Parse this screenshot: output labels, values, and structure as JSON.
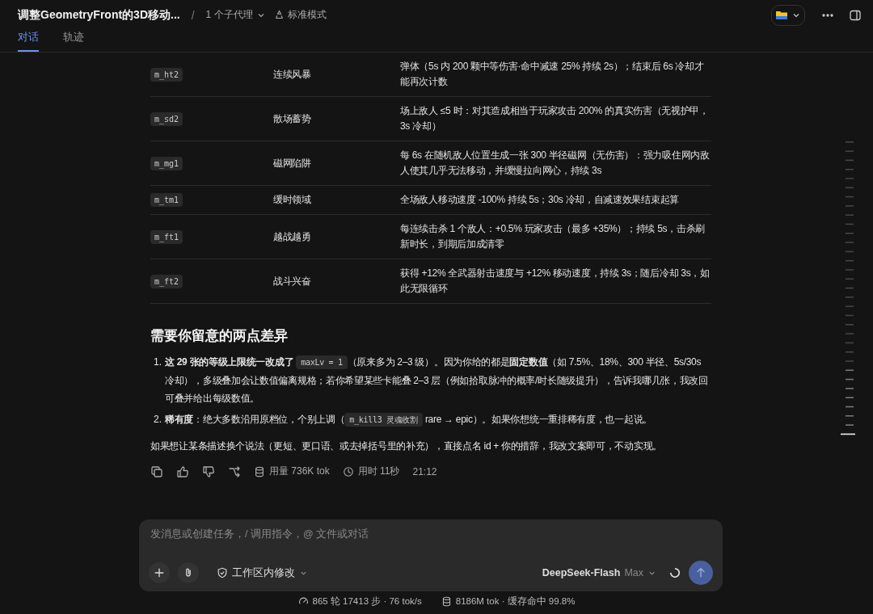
{
  "header": {
    "title": "调整GeometryFront的3D移动...",
    "separator": "/",
    "subagents": "1 个子代理",
    "mode": "标准模式"
  },
  "tabs": [
    {
      "label": "对话",
      "selected": true
    },
    {
      "label": "轨迹",
      "selected": false
    }
  ],
  "table": {
    "rows": [
      {
        "id": "m_ht2",
        "name": "连续风暴",
        "description": "弹体（5s 内 200 颗中等伤害·命中减速 25% 持续 2s）；结束后 6s 冷却才能再次计数"
      },
      {
        "id": "m_sd2",
        "name": "散场蓄势",
        "description": "场上敌人 ≤5 时：对其造成相当于玩家攻击 200% 的真实伤害（无视护甲，3s 冷却）"
      },
      {
        "id": "m_mg1",
        "name": "磁网陷阱",
        "description": "每 6s 在随机敌人位置生成一张 300 半径磁网（无伤害）：强力吸住网内敌人使其几乎无法移动，并缓慢拉向网心，持续 3s"
      },
      {
        "id": "m_tm1",
        "name": "缓时领域",
        "description": "全场敌人移动速度 -100% 持续 5s；30s 冷却，自减速效果结束起算"
      },
      {
        "id": "m_ft1",
        "name": "越战越勇",
        "description": "每连续击杀 1 个敌人：+0.5% 玩家攻击（最多 +35%）；持续 5s，击杀刷新时长，到期后加成清零"
      },
      {
        "id": "m_ft2",
        "name": "战斗兴奋",
        "description": "获得 +12% 全武器射击速度与 +12% 移动速度，持续 3s；随后冷却 3s，如此无限循环"
      }
    ]
  },
  "heading": "需要你留意的两点差异",
  "list": [
    {
      "number": "1.",
      "segments": [
        {
          "kind": "text",
          "text": "**这 29 张的等级上限统一改成了** "
        },
        {
          "kind": "code",
          "text": "maxLv = 1"
        },
        {
          "kind": "text",
          "text": "（原来多为 2–3 级）。因为你给的都是**固定数值**（如 7.5%、18%、300 半径、5s/30s 冷却），多级叠加会让数值偏离规格；若你希望某些卡能叠 2–3 层（例如拾取脉冲的概率/时长随级提升），告诉我哪几张，我改回可叠并给出每级数值。"
        }
      ]
    },
    {
      "number": "2.",
      "segments": [
        {
          "kind": "text",
          "text": "**稀有度**：绝大多数沿用原档位，个别上调（"
        },
        {
          "kind": "code",
          "text": "m_kill3 灵魂收割"
        },
        {
          "kind": "text",
          "text": " rare → epic）。如果你想统一重排稀有度，也一起说。"
        }
      ]
    }
  ],
  "paragraph": "如果想让某条描述换个说法（更短、更口语、或去掉括号里的补充），直接点名 id + 你的措辞，我改文案即可，不动实现。",
  "message_meta": {
    "usage": "用量 736K tok",
    "duration": "用时 11秒",
    "time": "21:12"
  },
  "composer": {
    "placeholder": "发消息或创建任务，/ 调用指令，@ 文件或对话",
    "scope": "工作区内修改",
    "model": "DeepSeek-Flash",
    "effort": "Max"
  },
  "status_bar": {
    "rounds": "865 轮 17413 步 · 76 tok/s",
    "cache": "8186M tok · 缓存命中 99.8%"
  }
}
